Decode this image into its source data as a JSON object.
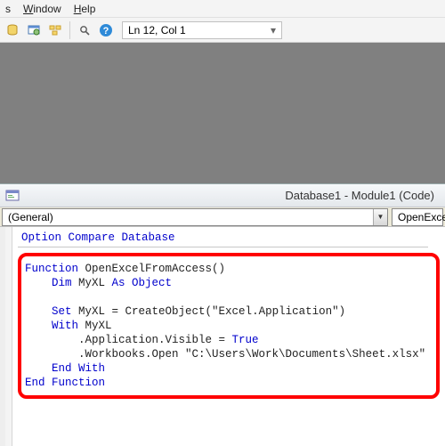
{
  "menu": {
    "items": [
      "s",
      "Window",
      "Help"
    ]
  },
  "toolbar": {
    "location_text": "Ln 12, Col 1"
  },
  "code_window": {
    "title": "Database1 - Module1 (Code)",
    "combo_left": "(General)",
    "combo_right": "OpenExce"
  },
  "code": {
    "option_line": "Option Compare Database",
    "lines": [
      {
        "t": "Function ",
        "k": true,
        "r": "OpenExcelFromAccess()"
      },
      {
        "indent": 1,
        "t": "Dim ",
        "k": true,
        "r1": "MyXL ",
        "t2": "As Object",
        "k2": true
      },
      {
        "blank": true
      },
      {
        "indent": 1,
        "t": "Set ",
        "k": true,
        "r": "MyXL = CreateObject(\"Excel.Application\")"
      },
      {
        "indent": 1,
        "t": "With ",
        "k": true,
        "r": "MyXL"
      },
      {
        "indent": 2,
        "r": ".Application.Visible = ",
        "t2": "True",
        "k2": true
      },
      {
        "indent": 2,
        "r": ".Workbooks.Open \"C:\\Users\\Work\\Documents\\Sheet.xlsx\""
      },
      {
        "indent": 1,
        "t": "End With",
        "k": true
      },
      {
        "t": "End Function",
        "k": true
      }
    ]
  }
}
